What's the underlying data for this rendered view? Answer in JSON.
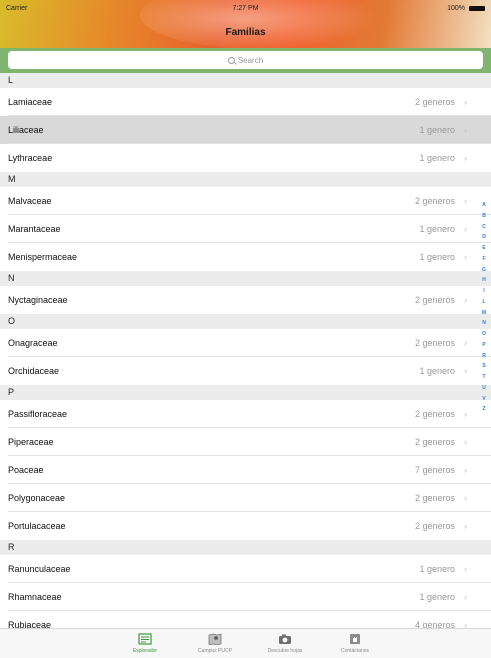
{
  "status_bar": {
    "carrier": "Carrier",
    "time": "7:27 PM",
    "battery": "100%"
  },
  "nav": {
    "title": "Familias"
  },
  "search": {
    "placeholder": "Search"
  },
  "sections": [
    {
      "letter": "L",
      "rows": [
        {
          "name": "Lamiaceae",
          "count": "2 generos"
        },
        {
          "name": "Liliaceae",
          "count": "1 genero",
          "selected": true
        },
        {
          "name": "Lythraceae",
          "count": "1 genero"
        }
      ]
    },
    {
      "letter": "M",
      "rows": [
        {
          "name": "Malvaceae",
          "count": "2 generos"
        },
        {
          "name": "Marantaceae",
          "count": "1 genero"
        },
        {
          "name": "Menispermaceae",
          "count": "1 genero"
        }
      ]
    },
    {
      "letter": "N",
      "rows": [
        {
          "name": "Nyctaginaceae",
          "count": "2 generos"
        }
      ]
    },
    {
      "letter": "O",
      "rows": [
        {
          "name": "Onagraceae",
          "count": "2 generos"
        },
        {
          "name": "Orchidaceae",
          "count": "1 genero"
        }
      ]
    },
    {
      "letter": "P",
      "rows": [
        {
          "name": "Passifloraceae",
          "count": "2 generos"
        },
        {
          "name": "Piperaceae",
          "count": "2 generos"
        },
        {
          "name": "Poaceae",
          "count": "7 generos"
        },
        {
          "name": "Polygonaceae",
          "count": "2 generos"
        },
        {
          "name": "Portulacaceae",
          "count": "2 generos"
        }
      ]
    },
    {
      "letter": "R",
      "rows": [
        {
          "name": "Ranunculaceae",
          "count": "1 genero"
        },
        {
          "name": "Rhamnaceae",
          "count": "1 genero"
        },
        {
          "name": "Rubiaceae",
          "count": "4 generos"
        }
      ]
    }
  ],
  "index_letters": [
    "A",
    "B",
    "C",
    "D",
    "E",
    "F",
    "G",
    "H",
    "I",
    "L",
    "M",
    "N",
    "O",
    "P",
    "R",
    "S",
    "T",
    "U",
    "V",
    "Z"
  ],
  "tabs": [
    {
      "label": "Explorador",
      "icon": "list-icon",
      "active": true
    },
    {
      "label": "Campus PUCP",
      "icon": "map-icon",
      "active": false
    },
    {
      "label": "Descubre hojas",
      "icon": "camera-icon",
      "active": false
    },
    {
      "label": "Contáctanos",
      "icon": "hand-icon",
      "active": false
    }
  ],
  "colors": {
    "accent": "#3f9a3c",
    "search_bar": "#7fb56e",
    "index": "#2a7de1"
  }
}
